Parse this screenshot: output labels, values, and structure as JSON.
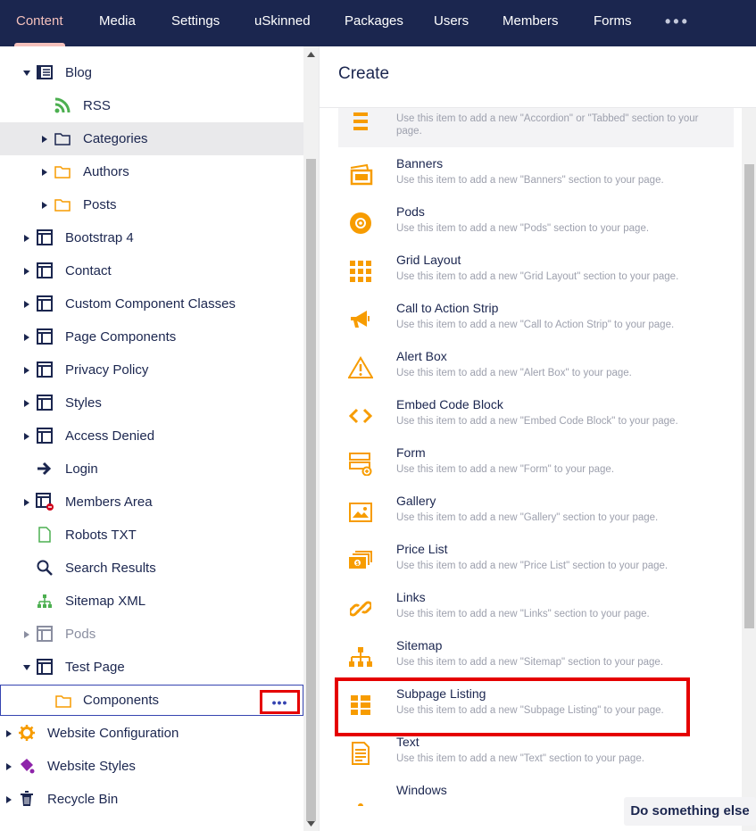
{
  "topnav": {
    "items": [
      "Content",
      "Media",
      "Settings",
      "uSkinned",
      "Packages",
      "Users",
      "Members",
      "Forms"
    ],
    "more": "•••"
  },
  "tree": {
    "items": [
      {
        "label": "Blog",
        "icon": "list-page-icon",
        "expanded": true
      },
      {
        "label": "RSS",
        "icon": "rss-icon"
      },
      {
        "label": "Categories",
        "icon": "folder-outline-icon"
      },
      {
        "label": "Authors",
        "icon": "folder-icon"
      },
      {
        "label": "Posts",
        "icon": "folder-icon"
      },
      {
        "label": "Bootstrap 4",
        "icon": "page-layout-icon"
      },
      {
        "label": "Contact",
        "icon": "page-layout-icon"
      },
      {
        "label": "Custom Component Classes",
        "icon": "page-layout-icon"
      },
      {
        "label": "Page Components",
        "icon": "page-layout-icon"
      },
      {
        "label": "Privacy Policy",
        "icon": "page-layout-icon"
      },
      {
        "label": "Styles",
        "icon": "page-layout-icon"
      },
      {
        "label": "Access Denied",
        "icon": "page-layout-icon"
      },
      {
        "label": "Login",
        "icon": "arrow-right-icon"
      },
      {
        "label": "Members Area",
        "icon": "protected-page-icon"
      },
      {
        "label": "Robots TXT",
        "icon": "document-icon"
      },
      {
        "label": "Search Results",
        "icon": "search-icon"
      },
      {
        "label": "Sitemap XML",
        "icon": "sitemap-icon"
      },
      {
        "label": "Pods",
        "icon": "page-layout-icon"
      },
      {
        "label": "Test Page",
        "icon": "page-layout-icon",
        "expanded": true
      },
      {
        "label": "Components",
        "icon": "folder-icon"
      },
      {
        "label": "Website Configuration",
        "icon": "gear-icon"
      },
      {
        "label": "Website Styles",
        "icon": "paint-icon"
      },
      {
        "label": "Recycle Bin",
        "icon": "trash-icon"
      }
    ],
    "actions_label": "•••"
  },
  "panel": {
    "title": "Create",
    "items": [
      {
        "title": "",
        "desc": "Use this item to add a new \"Accordion\" or \"Tabbed\" section to your"
      },
      {
        "title": "Banners",
        "desc": "Use this item to add a new \"Banners\" section to your page."
      },
      {
        "title": "Pods",
        "desc": "Use this item to add a new \"Pods\" section to your page."
      },
      {
        "title": "Grid Layout",
        "desc": "Use this item to add a new \"Grid Layout\" section to your page."
      },
      {
        "title": "Call to Action Strip",
        "desc": "Use this item to add a new \"Call to Action Strip\" to your page."
      },
      {
        "title": "Alert Box",
        "desc": "Use this item to add a new \"Alert Box\" to your page."
      },
      {
        "title": "Embed Code Block",
        "desc": "Use this item to add a new \"Embed Code Block\" to your page."
      },
      {
        "title": "Form",
        "desc": "Use this item to add a new \"Form\" to your page."
      },
      {
        "title": "Gallery",
        "desc": "Use this item to add a new \"Gallery\" section to your page."
      },
      {
        "title": "Price List",
        "desc": "Use this item to add a new \"Price List\" section to your page."
      },
      {
        "title": "Links",
        "desc": "Use this item to add a new \"Links\" section to your page."
      },
      {
        "title": "Sitemap",
        "desc": "Use this item to add a new \"Sitemap\" section to your page."
      },
      {
        "title": "Subpage Listing",
        "desc": "Use this item to add a new \"Subpage Listing\" to your page."
      },
      {
        "title": "Text",
        "desc": "Use this item to add a new \"Text\" section to your page."
      },
      {
        "title": "Windows",
        "desc": ""
      }
    ],
    "first_desc_line2": "page."
  },
  "footer": {
    "do_something_else": "Do something else"
  },
  "colors": {
    "nav_bg": "#1b264f",
    "accent": "#f5c1bc",
    "orange": "#f79c00",
    "highlight_red": "#e50000"
  }
}
